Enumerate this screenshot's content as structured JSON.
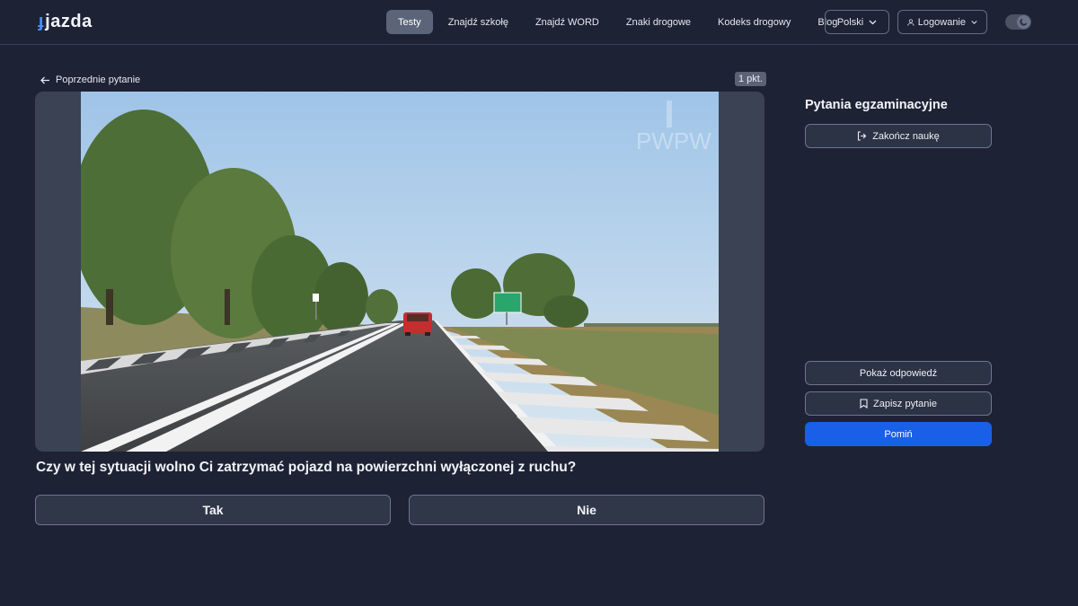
{
  "header": {
    "logo_text": "jazda",
    "nav": [
      "Testy",
      "Znajdź szkołę",
      "Znajdź WORD",
      "Znaki drogowe",
      "Kodeks drogowy",
      "Blog"
    ],
    "active_nav": "Testy",
    "language": "Polski",
    "login": "Logowanie"
  },
  "main": {
    "back_label": "Poprzednie pytanie",
    "points": "1 pkt.",
    "watermark": "PWPW",
    "question": "Czy w tej sytuacji wolno Ci zatrzymać pojazd na powierzchni wyłączonej z ruchu?",
    "answers": [
      "Tak",
      "Nie"
    ]
  },
  "sidebar": {
    "title": "Pytania egzaminacyjne",
    "finish_label": "Zakończ naukę",
    "show_answer_label": "Pokaż odpowiedź",
    "save_label": "Zapisz pytanie",
    "skip_label": "Pomiń"
  },
  "colors": {
    "background": "#1d2334",
    "accent": "#1a5fe8",
    "logo_accent": "#4d8df7"
  },
  "icons": [
    "arrow-left-icon",
    "chevron-down-icon",
    "user-icon",
    "moon-icon",
    "logout-icon",
    "bookmark-icon"
  ]
}
